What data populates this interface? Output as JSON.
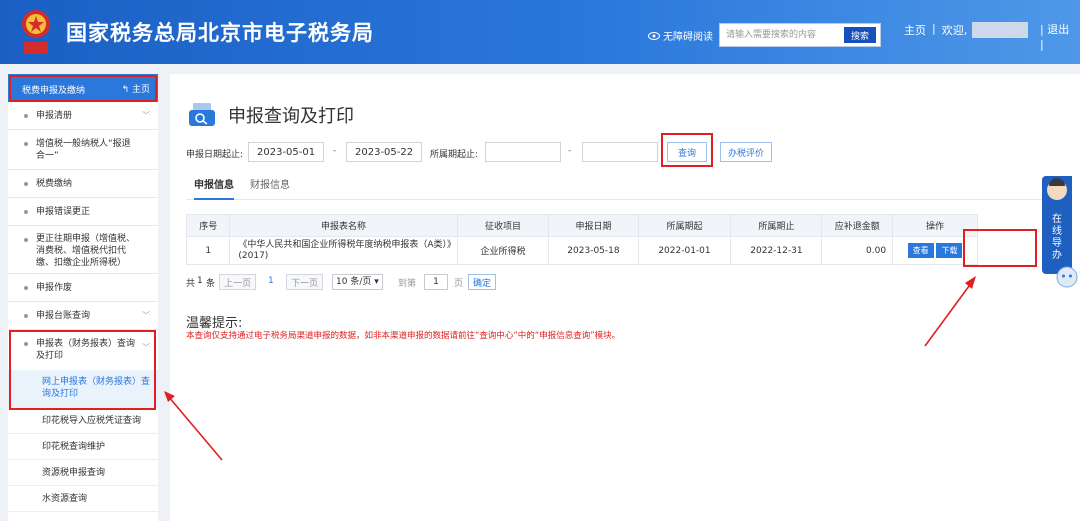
{
  "header": {
    "site_title": "国家税务总局北京市电子税务局",
    "access_label": "无障碍阅读",
    "search_placeholder": "请输入需要搜索的内容",
    "search_button": "搜索",
    "home_link": "主页",
    "separator": "|",
    "welcome": "欢迎,",
    "logout": "退出"
  },
  "sidebar": {
    "header_title": "税费申报及缴纳",
    "home_label": "主页",
    "items": [
      {
        "label": "申报清册"
      },
      {
        "label": "增值税一般纳税人“报退合一”"
      },
      {
        "label": "税费缴纳"
      },
      {
        "label": "申报错误更正"
      },
      {
        "label": "更正往期申报（增值税、消费税、增值税代扣代缴、扣缴企业所得税）"
      },
      {
        "label": "申报作废"
      },
      {
        "label": "申报台账查询"
      },
      {
        "label": "申报表（财务报表）查询及打印"
      }
    ],
    "subitems": [
      {
        "label": "网上申报表（财务报表）查询及打印"
      },
      {
        "label": "印花税导入应税凭证查询"
      },
      {
        "label": "印花税查询维护"
      },
      {
        "label": "资源税申报查询"
      },
      {
        "label": "水资源查询"
      }
    ]
  },
  "main": {
    "page_title": "申报查询及打印",
    "filters": {
      "date_label": "申报日期起止:",
      "date_start": "2023-05-01",
      "date_end": "2023-05-22",
      "dash": "-",
      "period_label": "所属期起止:",
      "period_start": "",
      "period_end": "",
      "query_button": "查询",
      "evaluate_button": "办税评价"
    },
    "tabs": [
      {
        "label": "申报信息"
      },
      {
        "label": "财报信息"
      }
    ],
    "table": {
      "headers": [
        "序号",
        "申报表名称",
        "征收项目",
        "申报日期",
        "所属期起",
        "所属期止",
        "应补退金额",
        "操作"
      ],
      "rows": [
        {
          "index": "1",
          "name": "《中华人民共和国企业所得税年度纳税申报表（A类）》(2017)",
          "item": "企业所得税",
          "report_date": "2023-05-18",
          "period_start": "2022-01-01",
          "period_end": "2022-12-31",
          "amount": "0.00",
          "view_button": "查看",
          "download_button": "下载"
        }
      ]
    },
    "pager": {
      "total_prefix": "共",
      "total": "1",
      "total_suffix": "条",
      "prev": "上一页",
      "current": "1",
      "next": "下一页",
      "page_size": "10 条/页",
      "goto_label": "到第",
      "goto_value": "1",
      "page_unit": "页",
      "confirm": "确定"
    },
    "tip_title": "温馨提示:",
    "tip_text": "本查询仅支持通过电子税务局渠道申报的数据，如非本渠道申报的数据请前往“查询中心”中的“申报信息查询”模块。"
  },
  "float_nav": {
    "label": "在线导办"
  },
  "colors": {
    "header_blue": "#2a78dc",
    "annotation_red": "#e02020"
  }
}
